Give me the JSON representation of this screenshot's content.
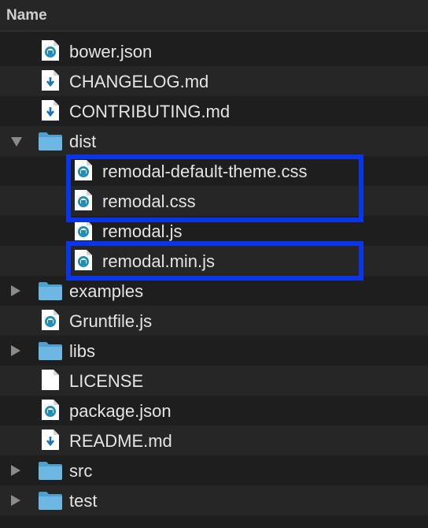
{
  "header": {
    "name_label": "Name"
  },
  "accent_color": "#0a35e8",
  "rows": [
    {
      "label": "bower.json",
      "icon": "grunt-file-icon",
      "indent": 0,
      "type": "file"
    },
    {
      "label": "CHANGELOG.md",
      "icon": "markdown-file-icon",
      "indent": 0,
      "type": "file"
    },
    {
      "label": "CONTRIBUTING.md",
      "icon": "markdown-file-icon",
      "indent": 0,
      "type": "file"
    },
    {
      "label": "dist",
      "icon": "folder-icon",
      "indent": 0,
      "type": "folder",
      "state": "expanded"
    },
    {
      "label": "remodal-default-theme.css",
      "icon": "grunt-file-icon",
      "indent": 1,
      "type": "file"
    },
    {
      "label": "remodal.css",
      "icon": "grunt-file-icon",
      "indent": 1,
      "type": "file"
    },
    {
      "label": "remodal.js",
      "icon": "grunt-file-icon",
      "indent": 1,
      "type": "file"
    },
    {
      "label": "remodal.min.js",
      "icon": "grunt-file-icon",
      "indent": 1,
      "type": "file"
    },
    {
      "label": "examples",
      "icon": "folder-icon",
      "indent": 0,
      "type": "folder",
      "state": "collapsed"
    },
    {
      "label": "Gruntfile.js",
      "icon": "grunt-file-icon",
      "indent": 0,
      "type": "file"
    },
    {
      "label": "libs",
      "icon": "folder-icon",
      "indent": 0,
      "type": "folder",
      "state": "collapsed"
    },
    {
      "label": "LICENSE",
      "icon": "blank-file-icon",
      "indent": 0,
      "type": "file"
    },
    {
      "label": "package.json",
      "icon": "grunt-file-icon",
      "indent": 0,
      "type": "file"
    },
    {
      "label": "README.md",
      "icon": "markdown-file-icon",
      "indent": 0,
      "type": "file"
    },
    {
      "label": "src",
      "icon": "folder-icon",
      "indent": 0,
      "type": "folder",
      "state": "collapsed"
    },
    {
      "label": "test",
      "icon": "folder-icon",
      "indent": 0,
      "type": "folder",
      "state": "collapsed"
    }
  ]
}
